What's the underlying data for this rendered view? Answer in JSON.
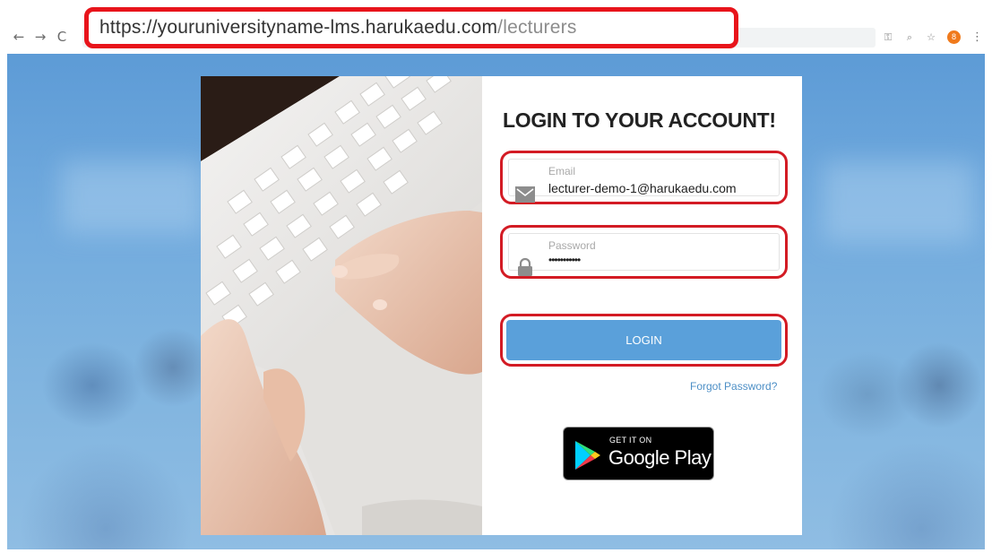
{
  "browser": {
    "url_host": "https://youruniversityname-lms.harukaedu.com",
    "url_sep": "/",
    "url_path": "lecturers",
    "extension_badge": "8",
    "nav": {
      "back": "←",
      "forward": "→",
      "reload": "C"
    },
    "toolbar_glyphs": {
      "key": "⚿",
      "zoom": "⌕",
      "star": "☆",
      "menu": "⋮"
    }
  },
  "login": {
    "title": "LOGIN TO YOUR ACCOUNT!",
    "email": {
      "label": "Email",
      "value": "lecturer-demo-1@harukaedu.com"
    },
    "password": {
      "label": "Password",
      "value": "•••••••••••"
    },
    "button_label": "LOGIN",
    "forgot_label": "Forgot Password?"
  },
  "store_badge": {
    "small_text": "GET IT ON",
    "big_text": "Google Play"
  },
  "colors": {
    "highlight_red": "#d31b24",
    "button_blue": "#5aa0da",
    "link_blue": "#4d8fc6",
    "background_blue": "#72abde"
  }
}
